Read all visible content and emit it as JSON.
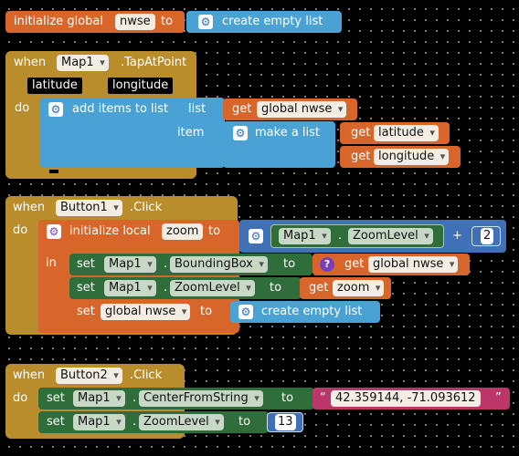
{
  "block1": {
    "initialize_global": "initialize global",
    "var_name": "nwse",
    "to": "to",
    "create_empty_list": "create empty list"
  },
  "block2": {
    "when": "when",
    "component": "Map1",
    "event": ".TapAtPoint",
    "param1": "latitude",
    "param2": "longitude",
    "do": "do",
    "add_items": "add items to list",
    "list_label": "list",
    "get": "get",
    "get_var": "global nwse",
    "item_label": "item",
    "make_a_list": "make a list",
    "get_latitude": "latitude",
    "get_longitude": "longitude"
  },
  "block3": {
    "when": "when",
    "component": "Button1",
    "event": ".Click",
    "do": "do",
    "initialize_local": "initialize local",
    "local_var": "zoom",
    "to": "to",
    "in": "in",
    "map_component": "Map1",
    "dot": ".",
    "zoom_prop": "ZoomLevel",
    "plus": "+",
    "num": "2",
    "set": "set",
    "bbox_prop": "BoundingBox",
    "get": "get",
    "get_global": "global nwse",
    "get_zoom": "zoom",
    "set_global": "global nwse",
    "create_empty_list": "create empty list"
  },
  "block4": {
    "when": "when",
    "component": "Button2",
    "event": ".Click",
    "do": "do",
    "set": "set",
    "map_component": "Map1",
    "dot": ".",
    "center_prop": "CenterFromString",
    "to": "to",
    "open_quote": "“",
    "center_value": "42.359144, -71.093612",
    "close_quote": "”",
    "zoom_prop": "ZoomLevel",
    "zoom_value": "13"
  },
  "icons": {
    "mutator_gear": "⚙",
    "help": "?"
  },
  "colors": {
    "variables": "#d8652a",
    "events": "#b98d2b",
    "lists": "#4aa1d3",
    "math": "#4071b7",
    "component_setters": "#2f6e3a",
    "text": "#bc366a"
  }
}
